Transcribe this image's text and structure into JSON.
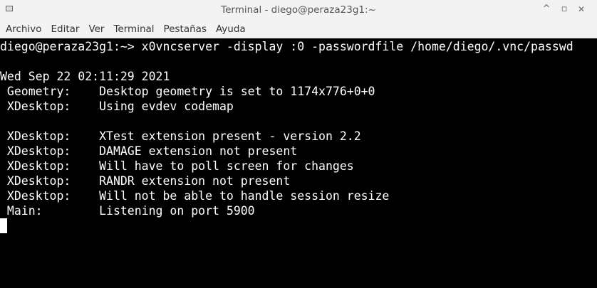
{
  "window": {
    "title": "Terminal - diego@peraza23g1:~",
    "buttons": {
      "minimize": "^",
      "maximize": "▫",
      "close": "✕"
    }
  },
  "menubar": {
    "items": [
      "Archivo",
      "Editar",
      "Ver",
      "Terminal",
      "Pestañas",
      "Ayuda"
    ]
  },
  "terminal": {
    "lines": [
      "diego@peraza23g1:~> x0vncserver -display :0 -passwordfile /home/diego/.vnc/passwd",
      "",
      "Wed Sep 22 02:11:29 2021",
      " Geometry:    Desktop geometry is set to 1174x776+0+0",
      " XDesktop:    Using evdev codemap",
      "",
      " XDesktop:    XTest extension present - version 2.2",
      " XDesktop:    DAMAGE extension not present",
      " XDesktop:    Will have to poll screen for changes",
      " XDesktop:    RANDR extension not present",
      " XDesktop:    Will not be able to handle session resize",
      " Main:        Listening on port 5900"
    ],
    "colors": {
      "background": "#000000",
      "foreground": "#ffffff"
    }
  }
}
